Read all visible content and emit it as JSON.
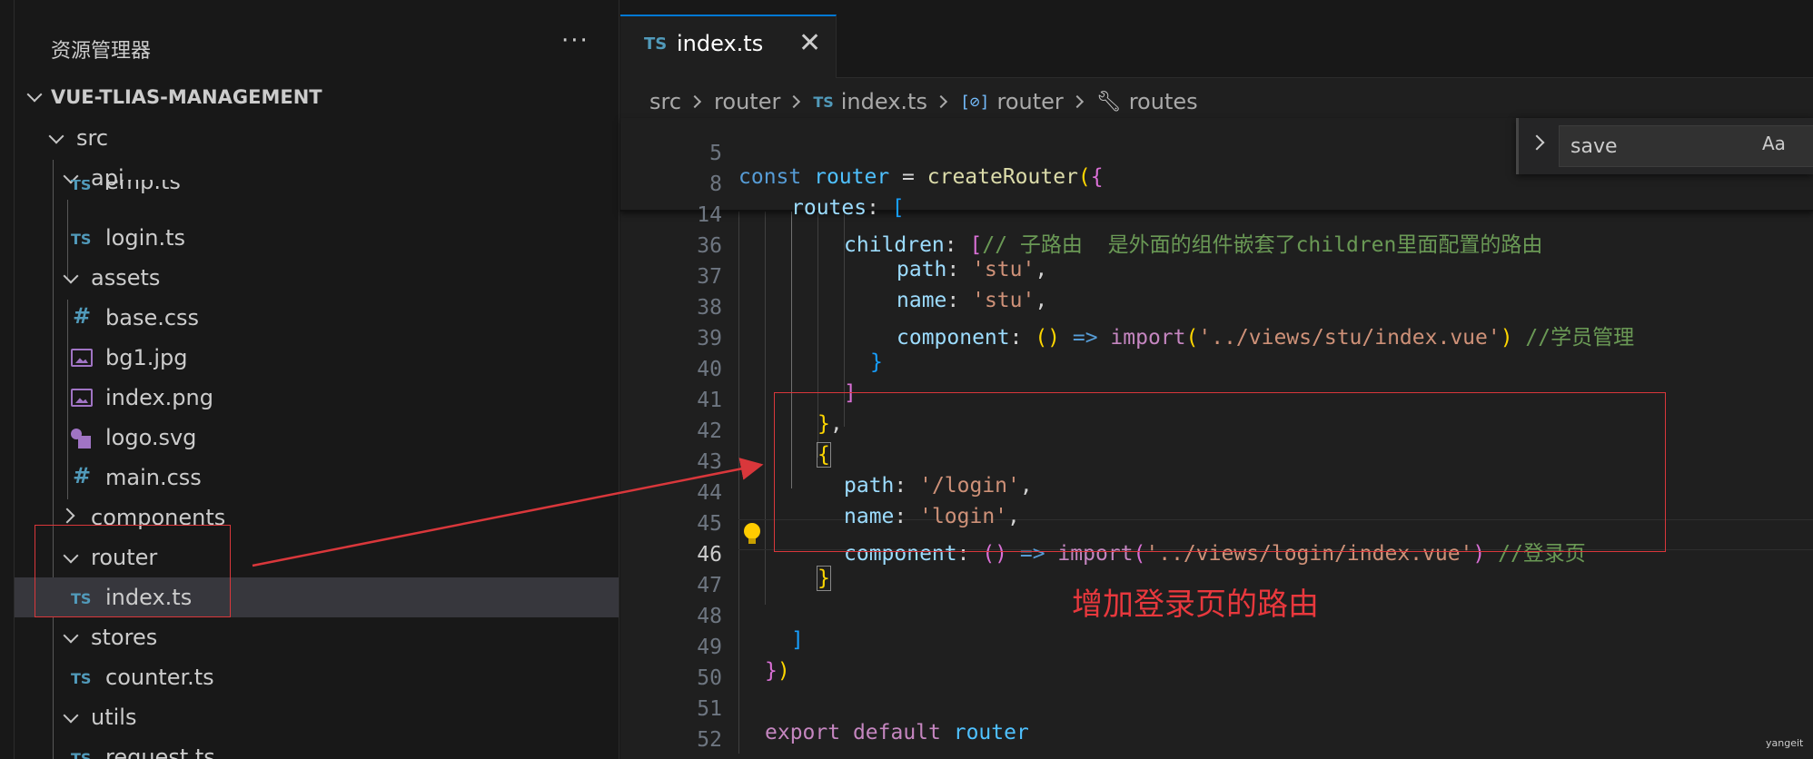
{
  "sidebar": {
    "title": "资源管理器",
    "more_label": "···",
    "project": "VUE-TLIAS-MANAGEMENT",
    "items": [
      {
        "label": "src",
        "icon": "chevron-down-icon"
      },
      {
        "label": "api",
        "icon": "chevron-down-icon"
      },
      {
        "label": "emp.ts",
        "icon": "TS"
      },
      {
        "label": "login.ts",
        "icon": "TS"
      },
      {
        "label": "assets",
        "icon": "chevron-down-icon"
      },
      {
        "label": "base.css",
        "icon": "#"
      },
      {
        "label": "bg1.jpg",
        "icon": "image-icon"
      },
      {
        "label": "index.png",
        "icon": "image-icon"
      },
      {
        "label": "logo.svg",
        "icon": "svg-icon"
      },
      {
        "label": "main.css",
        "icon": "#"
      },
      {
        "label": "components",
        "icon": "chevron-right-icon"
      },
      {
        "label": "router",
        "icon": "chevron-down-icon"
      },
      {
        "label": "index.ts",
        "icon": "TS"
      },
      {
        "label": "stores",
        "icon": "chevron-down-icon"
      },
      {
        "label": "counter.ts",
        "icon": "TS"
      },
      {
        "label": "utils",
        "icon": "chevron-down-icon"
      },
      {
        "label": "request.ts",
        "icon": "TS"
      }
    ]
  },
  "tab": {
    "icon": "TS",
    "label": "index.ts",
    "close": "✕"
  },
  "breadcrumb": {
    "src": "src",
    "router": "router",
    "file_icon": "TS",
    "file": "index.ts",
    "symbol1": "router",
    "symbol2": "routes",
    "bracket_icon": "[⊘]",
    "wrench_icon": "🔧"
  },
  "find": {
    "value": "save",
    "case_label": "Aa"
  },
  "code": {
    "line_numbers": [
      "5",
      "8",
      "14",
      "36",
      "37",
      "38",
      "39",
      "40",
      "41",
      "42",
      "43",
      "44",
      "45",
      "46",
      "47",
      "48",
      "49",
      "50",
      "51",
      "52"
    ],
    "lines": {
      "l5": {
        "kw": "const",
        "var": "router",
        "eq": " = ",
        "fn": "createRouter",
        "p": "(",
        "b": "{"
      },
      "l8": {
        "prop": "routes",
        "colon": ": ",
        "b": "["
      },
      "l14": {
        "prop": "children",
        "colon": ": ",
        "b": "[",
        "cm": "// 子路由  是外面的组件嵌套了children里面配置的路由"
      },
      "l36": {
        "prop": "path",
        "colon": ": ",
        "str": "'stu'",
        "comma": ","
      },
      "l37": {
        "prop": "name",
        "colon": ": ",
        "str": "'stu'",
        "comma": ","
      },
      "l38": {
        "prop": "component",
        "colon": ": ",
        "p1": "()",
        "arrow": " => ",
        "kw": "import",
        "p2": "(",
        "str": "'../views/stu/index.vue'",
        "p3": ")",
        "cm": " //学员管理"
      },
      "l39": {
        "b": "}"
      },
      "l40": {
        "b": "]"
      },
      "l41": {
        "b": "}",
        "comma": ","
      },
      "l42": {
        "b": "{"
      },
      "l43": {
        "prop": "path",
        "colon": ": ",
        "str": "'/login'",
        "comma": ","
      },
      "l44": {
        "prop": "name",
        "colon": ": ",
        "str": "'login'",
        "comma": ","
      },
      "l45": {
        "prop": "component",
        "colon": ": ",
        "p1": "()",
        "arrow": " => ",
        "kw": "import",
        "p2": "(",
        "str": "'../views/login/index.vue'",
        "p3": ")",
        "cm": " //登录页"
      },
      "l46": {
        "b": "}"
      },
      "l48": {
        "b": "]"
      },
      "l49": {
        "b1": "}",
        "b2": ")"
      },
      "l51": {
        "kw": "export",
        "kw2": " default ",
        "var": "router"
      }
    }
  },
  "annotation": {
    "text": "增加登录页的路由",
    "color": "#e8383d"
  },
  "watermark": "yangeit",
  "colors": {
    "background": "#1f1f1f",
    "sidebar": "#181818",
    "selected_row": "#37373d",
    "accent": "#0078d4",
    "annotation": "#d9373b"
  }
}
